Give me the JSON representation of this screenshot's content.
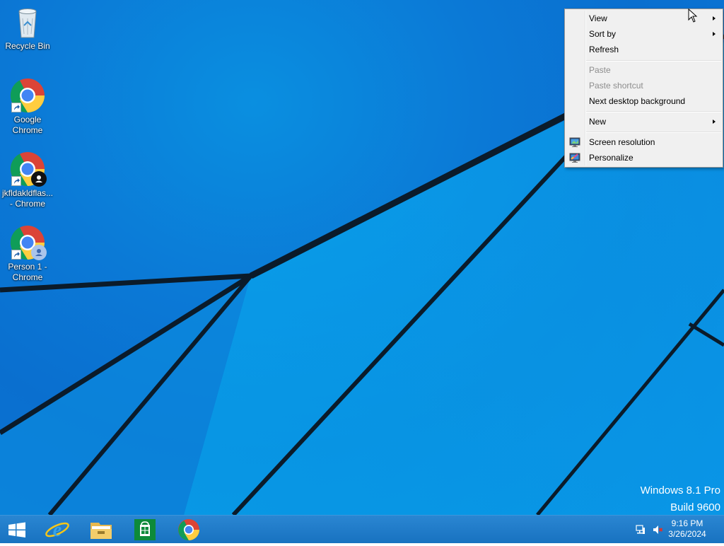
{
  "desktop": {
    "icons": [
      {
        "label": "Recycle Bin",
        "icon": "recycle-bin-icon"
      },
      {
        "label": "Google\nChrome",
        "icon": "chrome-icon"
      },
      {
        "label": "jkfldakldflas...\n- Chrome",
        "icon": "chrome-profile-icon"
      },
      {
        "label": "Person 1 -\nChrome",
        "icon": "chrome-profile-icon"
      }
    ],
    "watermark": {
      "line1": "Windows 8.1 Pro",
      "line2": "Build 9600"
    }
  },
  "context_menu": {
    "items": [
      {
        "label": "View",
        "submenu": true,
        "enabled": true
      },
      {
        "label": "Sort by",
        "submenu": true,
        "enabled": true
      },
      {
        "label": "Refresh",
        "enabled": true
      },
      {
        "label": "Paste",
        "enabled": false
      },
      {
        "label": "Paste shortcut",
        "enabled": false
      },
      {
        "label": "Next desktop background",
        "enabled": true
      },
      {
        "label": "New",
        "submenu": true,
        "enabled": true
      },
      {
        "label": "Screen resolution",
        "enabled": true,
        "icon": "screen-resolution-icon"
      },
      {
        "label": "Personalize",
        "enabled": true,
        "icon": "personalize-icon"
      }
    ]
  },
  "taskbar": {
    "pinned": [
      {
        "name": "start-button",
        "icon": "windows-logo-icon"
      },
      {
        "name": "internet-explorer",
        "icon": "internet-explorer-icon"
      },
      {
        "name": "file-explorer",
        "icon": "file-explorer-icon"
      },
      {
        "name": "store",
        "icon": "store-icon"
      },
      {
        "name": "chrome",
        "icon": "chrome-icon"
      }
    ],
    "tray": {
      "network_icon": "network-icon",
      "volume_icon": "volume-muted-icon",
      "time": "9:16 PM",
      "date": "3/26/2024"
    }
  },
  "colors": {
    "desktop_blue": "#0b79d6",
    "taskbar_blue": "#1b79c6",
    "menu_bg": "#f0f0f0"
  }
}
